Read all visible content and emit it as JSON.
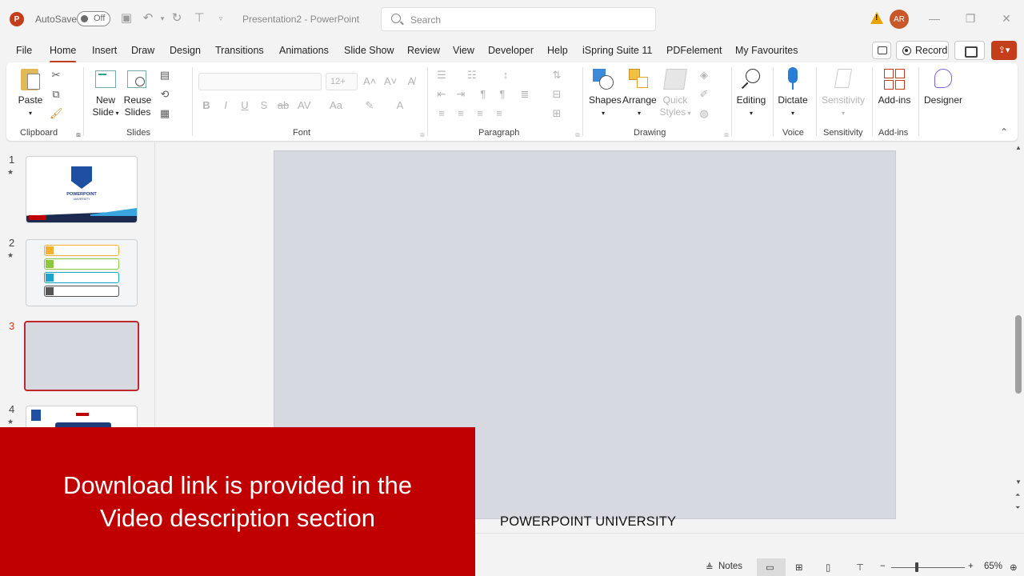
{
  "titlebar": {
    "app_logo": "P",
    "autosave_label": "AutoSave",
    "autosave_state": "Off",
    "document_title": "Presentation2  -  PowerPoint",
    "search_placeholder": "Search",
    "user_initials": "AR"
  },
  "tabs": [
    "File",
    "Home",
    "Insert",
    "Draw",
    "Design",
    "Transitions",
    "Animations",
    "Slide Show",
    "Review",
    "View",
    "Developer",
    "Help",
    "iSpring Suite 11",
    "PDFelement",
    "My Favourites"
  ],
  "active_tab": "Home",
  "header_actions": {
    "record_label": "Record"
  },
  "ribbon": {
    "clipboard": {
      "paste": "Paste",
      "label": "Clipboard"
    },
    "slides": {
      "new_slide_1": "New",
      "new_slide_2": "Slide",
      "reuse_1": "Reuse",
      "reuse_2": "Slides",
      "label": "Slides"
    },
    "font": {
      "size_placeholder": "12+",
      "label": "Font"
    },
    "paragraph": {
      "label": "Paragraph"
    },
    "drawing": {
      "shapes": "Shapes",
      "arrange": "Arrange",
      "quick_styles_1": "Quick",
      "quick_styles_2": "Styles",
      "label": "Drawing"
    },
    "editing": {
      "editing": "Editing"
    },
    "voice": {
      "dictate": "Dictate",
      "label": "Voice"
    },
    "sensitivity": {
      "sensitivity": "Sensitivity",
      "label": "Sensitivity"
    },
    "addins": {
      "addins": "Add-ins",
      "label": "Add-ins"
    },
    "designer": {
      "designer": "Designer"
    }
  },
  "thumbnails": [
    {
      "number": "1",
      "logo_text": "POWERPOINT",
      "logo_sub": "UNIVERSITY"
    },
    {
      "number": "2"
    },
    {
      "number": "3"
    },
    {
      "number": "4"
    }
  ],
  "slide_footer": "POWERPOINT UNIVERSITY",
  "statusbar": {
    "notes_label": "Notes",
    "zoom_level": "65%",
    "zoom_fraction": 0.35
  },
  "banner": {
    "line1": "Download link is provided in the",
    "line2": "Video description section"
  },
  "colors": {
    "accent": "#c43e1c",
    "banner_bg": "#c00000",
    "slide_bg": "#d6d9df",
    "selected_border": "#c0272d"
  }
}
